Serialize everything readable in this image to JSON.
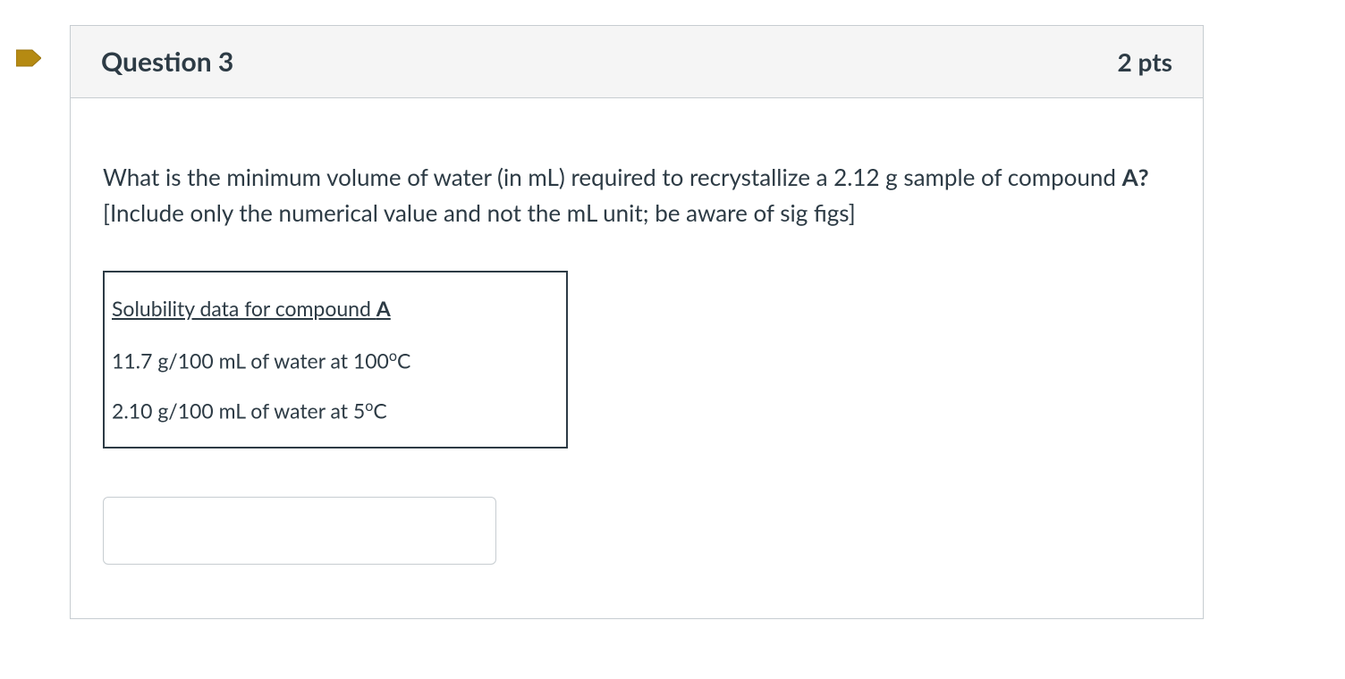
{
  "marker": {
    "color": "#b58a12"
  },
  "header": {
    "title": "Question 3",
    "points": "2 pts"
  },
  "prompt": {
    "before_bold": "What is the minimum volume of water (in mL) required to recrystallize a 2.12 g sample of compound ",
    "bold": "A?",
    "after_bold": " [Include only the numerical value and not the mL unit; be aware of sig figs]"
  },
  "solubility": {
    "title_before": "Solubility data for compound ",
    "title_bold": "A",
    "line1_before": "11.7 g/100 mL of water at 100",
    "line1_sup": "o",
    "line1_after": "C",
    "line2_before": "2.10 g/100 mL of water at 5",
    "line2_sup": "o",
    "line2_after": "C"
  },
  "answer": {
    "value": ""
  }
}
